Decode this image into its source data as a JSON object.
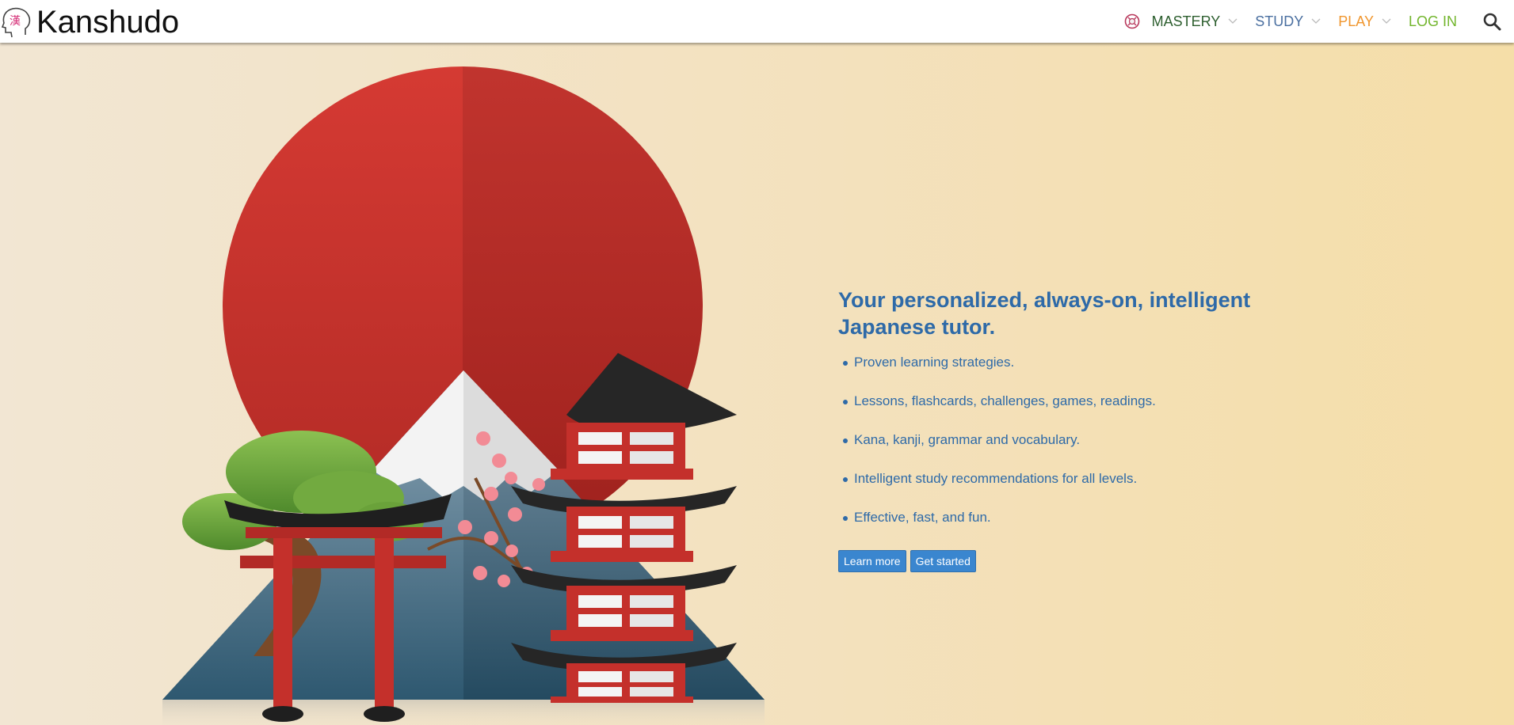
{
  "header": {
    "brand_name": "Kanshudo",
    "logo_glyph": "漢",
    "nav": {
      "mastery": "MASTERY",
      "study": "STUDY",
      "play": "PLAY",
      "login": "LOG IN"
    },
    "colors": {
      "mastery": "#2c5e2e",
      "study": "#4a6fa0",
      "play": "#f0962e",
      "login": "#72b52c",
      "logo_glyph": "#d6337a"
    }
  },
  "hero": {
    "headline": "Your personalized, always-on, intelligent Japanese tutor.",
    "features": [
      "Proven learning strategies.",
      "Lessons, flashcards, challenges, games, readings.",
      "Kana, kanji, grammar and vocabulary.",
      "Intelligent study recommendations for all levels.",
      "Effective, fast, and fun."
    ],
    "buttons": {
      "learn_more": "Learn more",
      "get_started": "Get started"
    },
    "accent_color": "#2e6aa8",
    "button_color": "#3a86cf"
  }
}
